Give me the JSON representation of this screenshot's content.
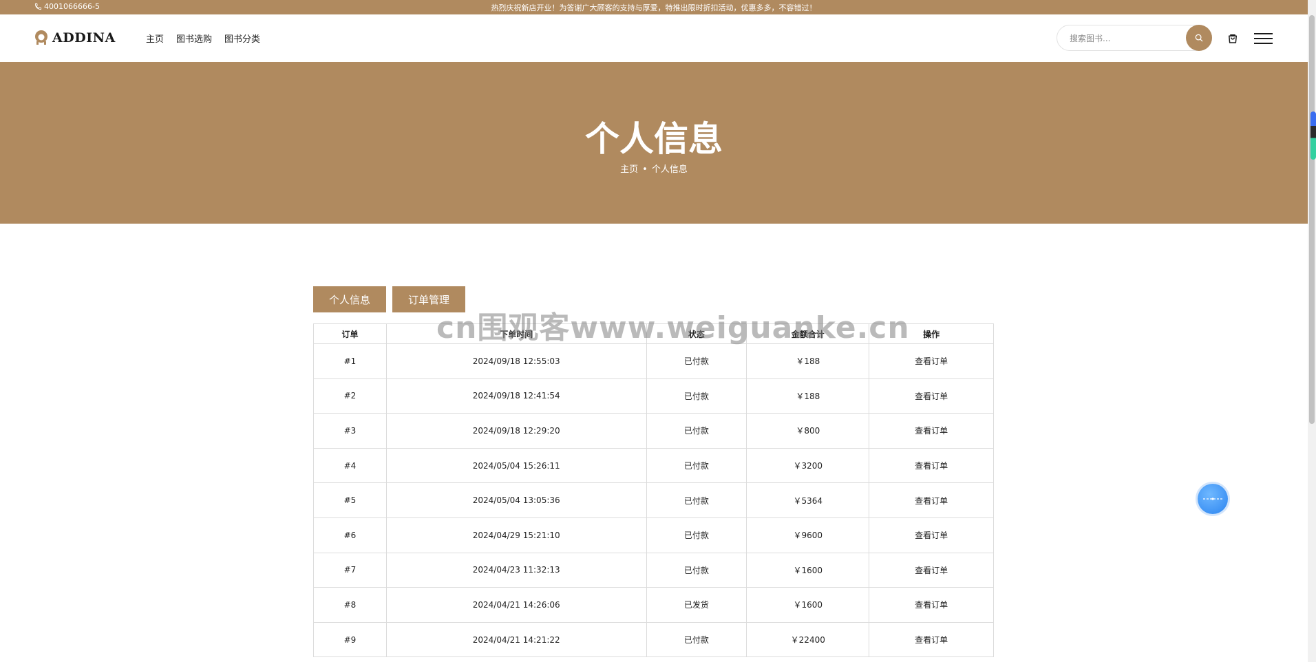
{
  "topbar": {
    "phone": "4001066666-5",
    "announcement": "热烈庆祝新店开业！为答谢广大顾客的支持与厚爱，特推出限时折扣活动，优惠多多，不容错过！"
  },
  "header": {
    "logo_text": "ADDINA",
    "nav": [
      "主页",
      "图书选购",
      "图书分类"
    ],
    "search_placeholder": "搜索图书..."
  },
  "banner": {
    "title": "个人信息",
    "breadcrumb_home": "主页",
    "breadcrumb_sep": "•",
    "breadcrumb_current": "个人信息"
  },
  "tabs": {
    "personal": "个人信息",
    "orders": "订单管理"
  },
  "table": {
    "headers": [
      "订单",
      "下单时间",
      "状态",
      "金额合计",
      "操作"
    ],
    "rows": [
      {
        "id": "#1",
        "time": "2024/09/18 12:55:03",
        "status": "已付款",
        "amount": "￥188",
        "action": "查看订单"
      },
      {
        "id": "#2",
        "time": "2024/09/18 12:41:54",
        "status": "已付款",
        "amount": "￥188",
        "action": "查看订单"
      },
      {
        "id": "#3",
        "time": "2024/09/18 12:29:20",
        "status": "已付款",
        "amount": "￥800",
        "action": "查看订单"
      },
      {
        "id": "#4",
        "time": "2024/05/04 15:26:11",
        "status": "已付款",
        "amount": "￥3200",
        "action": "查看订单"
      },
      {
        "id": "#5",
        "time": "2024/05/04 13:05:36",
        "status": "已付款",
        "amount": "￥5364",
        "action": "查看订单"
      },
      {
        "id": "#6",
        "time": "2024/04/29 15:21:10",
        "status": "已付款",
        "amount": "￥9600",
        "action": "查看订单"
      },
      {
        "id": "#7",
        "time": "2024/04/23 11:32:13",
        "status": "已付款",
        "amount": "￥1600",
        "action": "查看订单"
      },
      {
        "id": "#8",
        "time": "2024/04/21 14:26:06",
        "status": "已发货",
        "amount": "￥1600",
        "action": "查看订单"
      },
      {
        "id": "#9",
        "time": "2024/04/21 14:21:22",
        "status": "已付款",
        "amount": "￥22400",
        "action": "查看订单"
      }
    ]
  },
  "watermark": "cn围观客www.weiguanke.cn",
  "colors": {
    "brand": "#b08a5f",
    "float_button": "#2b84f0"
  },
  "icons": [
    "phone-icon",
    "logo-mark-icon",
    "search-icon",
    "cart-icon",
    "hamburger-menu-icon",
    "assistant-float-icon"
  ]
}
